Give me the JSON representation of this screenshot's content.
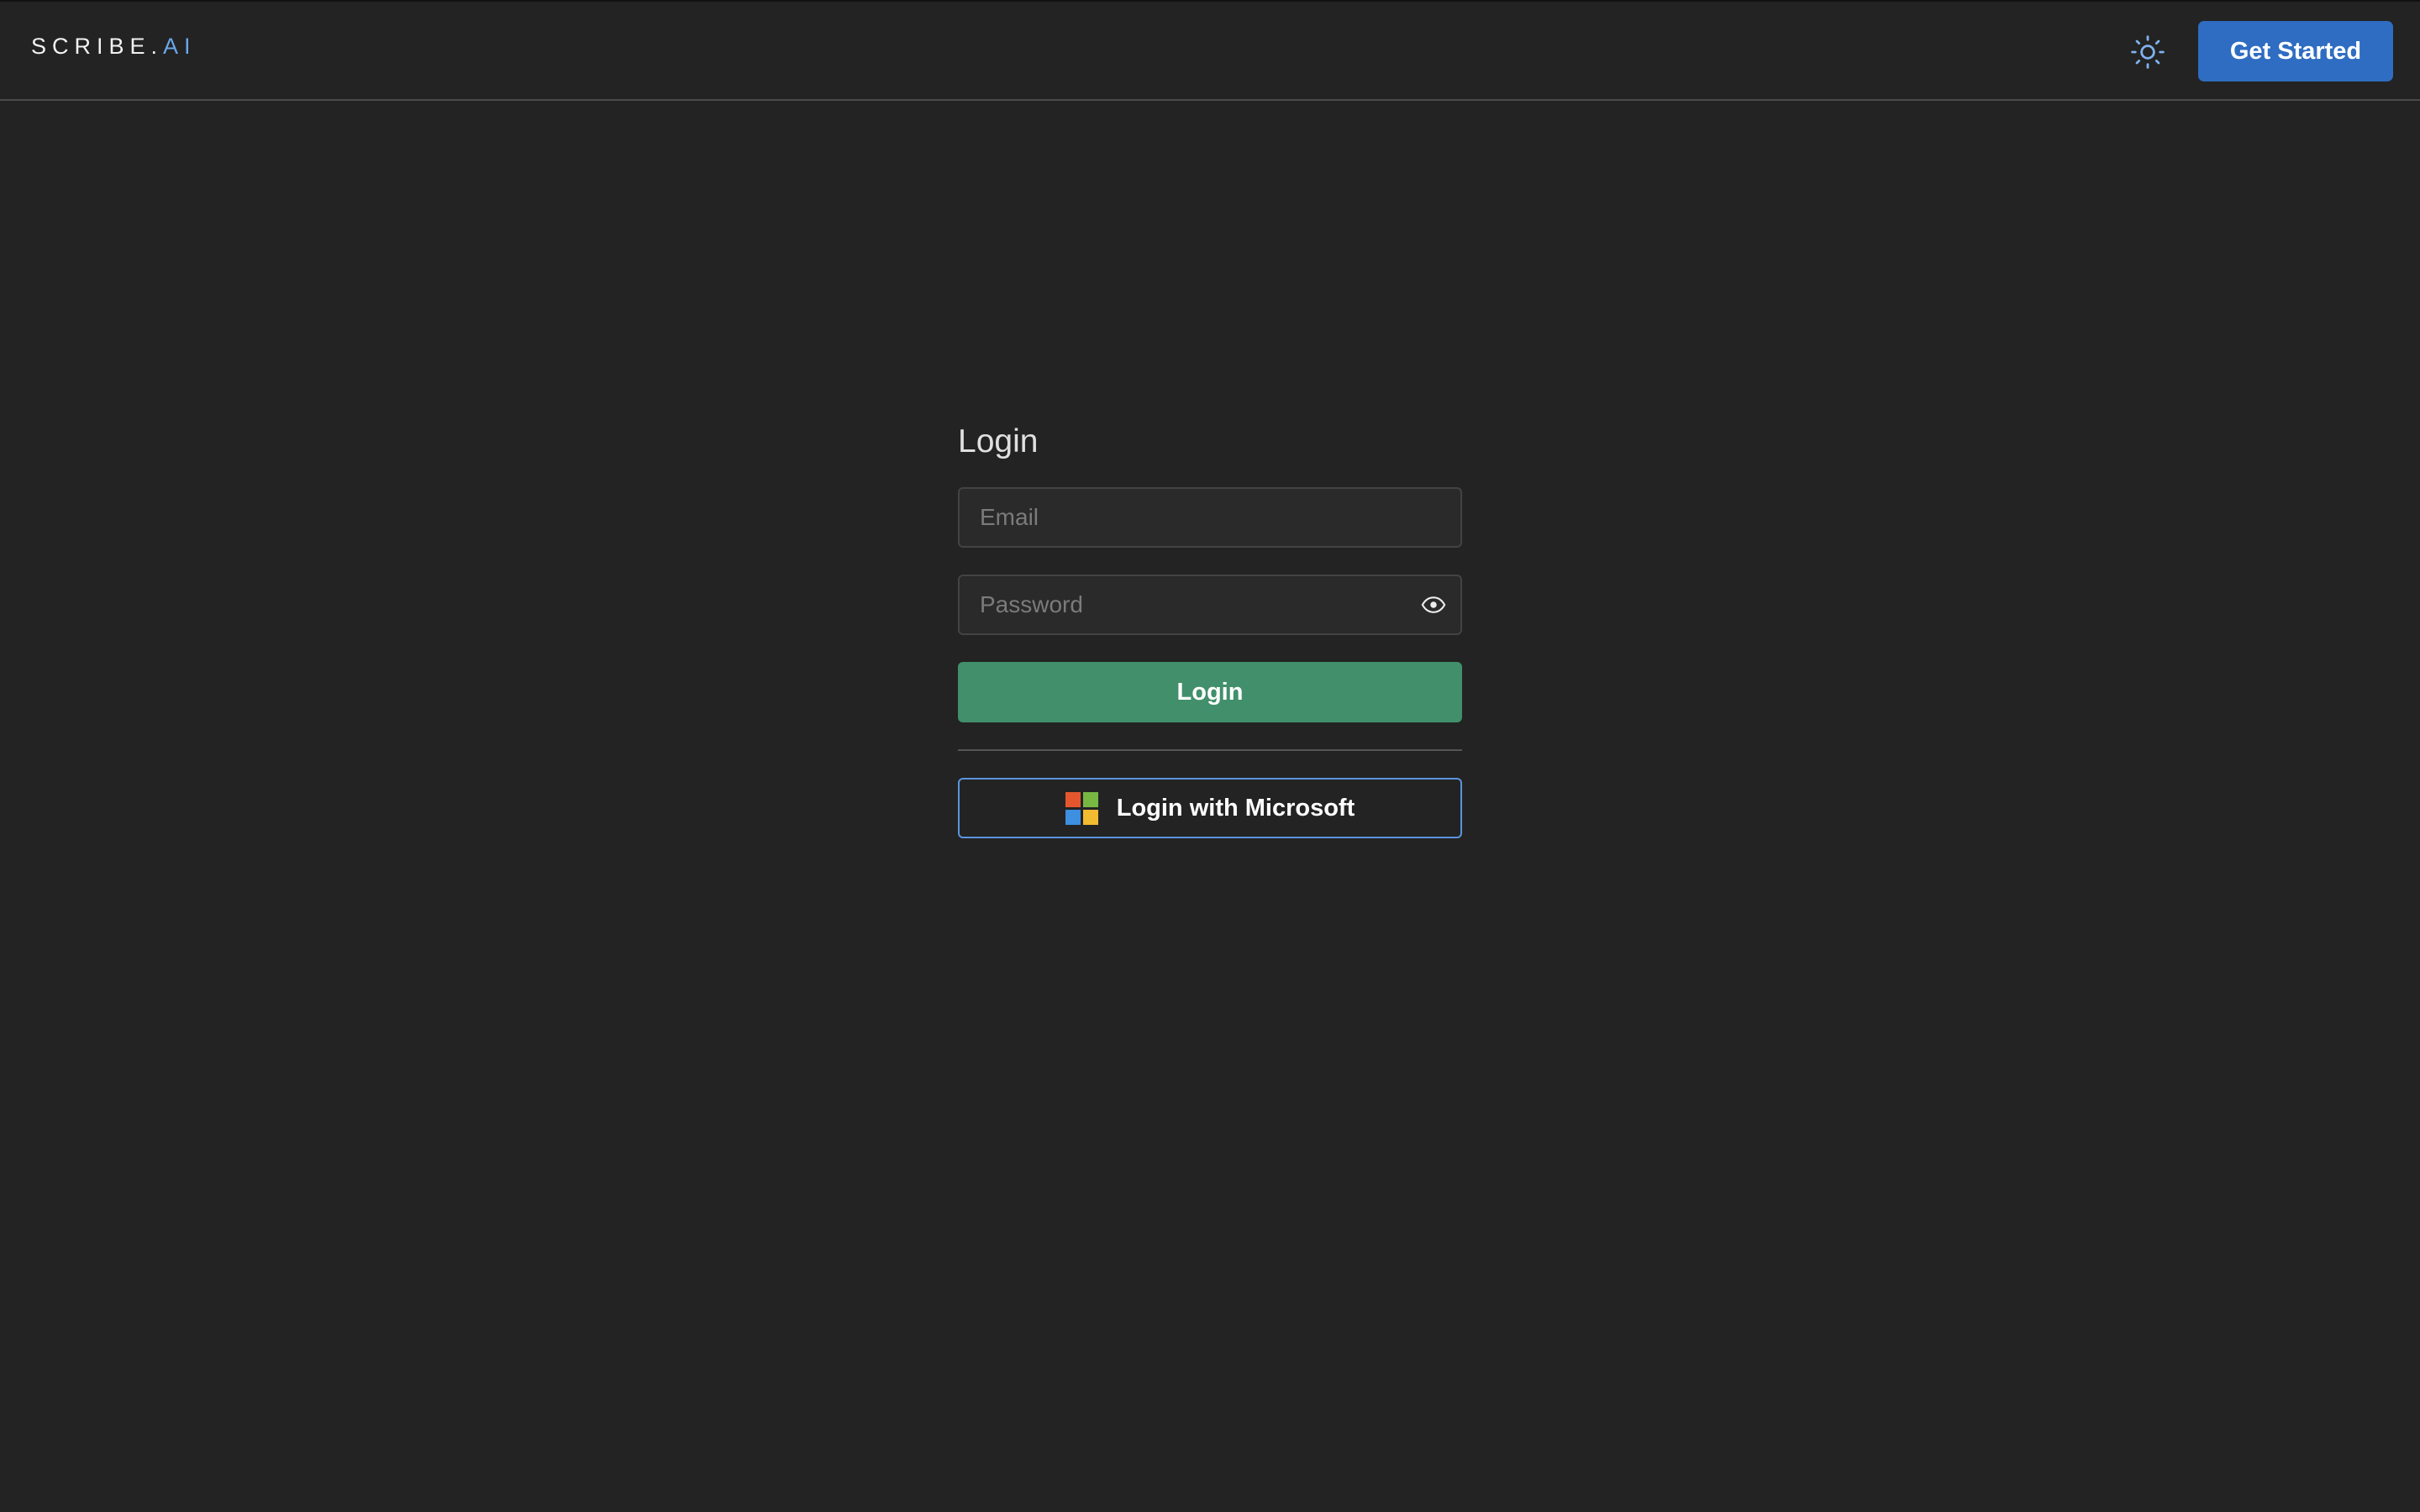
{
  "header": {
    "logo_main": "SCRIBE.",
    "logo_accent": "AI",
    "theme_icon": "sun-icon",
    "get_started_label": "Get Started"
  },
  "login": {
    "title": "Login",
    "email_placeholder": "Email",
    "email_value": "",
    "password_placeholder": "Password",
    "password_value": "",
    "show_password_icon": "eye-icon",
    "login_button_label": "Login",
    "microsoft_button_label": "Login with Microsoft",
    "microsoft_icon": "microsoft-logo-icon"
  },
  "colors": {
    "background": "#232323",
    "accent_blue": "#2f6dc2",
    "logo_accent": "#6aa6ea",
    "login_green": "#418f6b",
    "microsoft_border": "#5b94de",
    "ms_red": "#f25022",
    "ms_green": "#7fba00",
    "ms_blue": "#00a4ef",
    "ms_yellow": "#ffb900"
  }
}
